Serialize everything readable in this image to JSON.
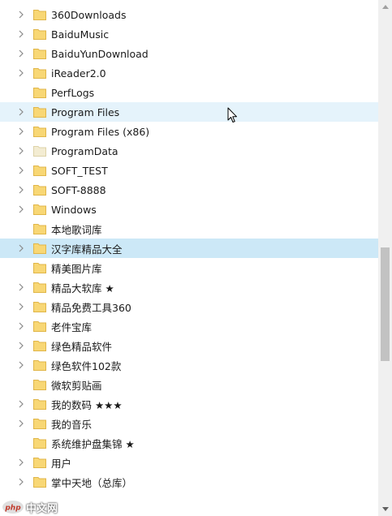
{
  "tree": {
    "items": [
      {
        "label": "360Downloads",
        "expandable": true,
        "state": "normal",
        "folder": "yellow"
      },
      {
        "label": "BaiduMusic",
        "expandable": true,
        "state": "normal",
        "folder": "yellow"
      },
      {
        "label": "BaiduYunDownload",
        "expandable": true,
        "state": "normal",
        "folder": "yellow"
      },
      {
        "label": "iReader2.0",
        "expandable": true,
        "state": "normal",
        "folder": "yellow"
      },
      {
        "label": "PerfLogs",
        "expandable": false,
        "state": "normal",
        "folder": "yellow"
      },
      {
        "label": "Program Files",
        "expandable": true,
        "state": "hover",
        "folder": "yellow"
      },
      {
        "label": "Program Files (x86)",
        "expandable": true,
        "state": "normal",
        "folder": "yellow"
      },
      {
        "label": "ProgramData",
        "expandable": true,
        "state": "normal",
        "folder": "pale"
      },
      {
        "label": "SOFT_TEST",
        "expandable": true,
        "state": "normal",
        "folder": "yellow"
      },
      {
        "label": "SOFT-8888",
        "expandable": true,
        "state": "normal",
        "folder": "yellow"
      },
      {
        "label": "Windows",
        "expandable": true,
        "state": "normal",
        "folder": "yellow"
      },
      {
        "label": "本地歌词库",
        "expandable": false,
        "state": "normal",
        "folder": "yellow"
      },
      {
        "label": "汉字库精品大全",
        "expandable": true,
        "state": "selected",
        "folder": "yellow"
      },
      {
        "label": "精美图片库",
        "expandable": false,
        "state": "normal",
        "folder": "yellow"
      },
      {
        "label": "精品大软库 ★",
        "expandable": true,
        "state": "normal",
        "folder": "yellow"
      },
      {
        "label": "精品免费工具360",
        "expandable": true,
        "state": "normal",
        "folder": "yellow"
      },
      {
        "label": "老件宝库",
        "expandable": true,
        "state": "normal",
        "folder": "yellow"
      },
      {
        "label": "绿色精品软件",
        "expandable": true,
        "state": "normal",
        "folder": "yellow"
      },
      {
        "label": "绿色软件102款",
        "expandable": true,
        "state": "normal",
        "folder": "yellow"
      },
      {
        "label": "微软剪贴画",
        "expandable": false,
        "state": "normal",
        "folder": "yellow"
      },
      {
        "label": "我的数码 ★★★",
        "expandable": true,
        "state": "normal",
        "folder": "yellow"
      },
      {
        "label": "我的音乐",
        "expandable": true,
        "state": "normal",
        "folder": "yellow"
      },
      {
        "label": "系统维护盘集锦 ★",
        "expandable": false,
        "state": "normal",
        "folder": "yellow"
      },
      {
        "label": "用户",
        "expandable": true,
        "state": "normal",
        "folder": "yellow"
      },
      {
        "label": "掌中天地（总库）",
        "expandable": true,
        "state": "normal",
        "folder": "yellow"
      }
    ]
  },
  "colors": {
    "hover_bg": "#e5f3fb",
    "selected_bg": "#cce8f7",
    "folder_yellow": "#f8d775",
    "folder_pale": "#f3ecd2",
    "chevron": "#8a8a8a"
  },
  "icons": {
    "expand": "chevron-right-icon",
    "folder": "folder-icon",
    "scroll_up": "triangle-up-icon",
    "scroll_down": "triangle-down-icon",
    "pointer": "mouse-cursor-icon"
  },
  "watermark": {
    "text": "中文网"
  }
}
